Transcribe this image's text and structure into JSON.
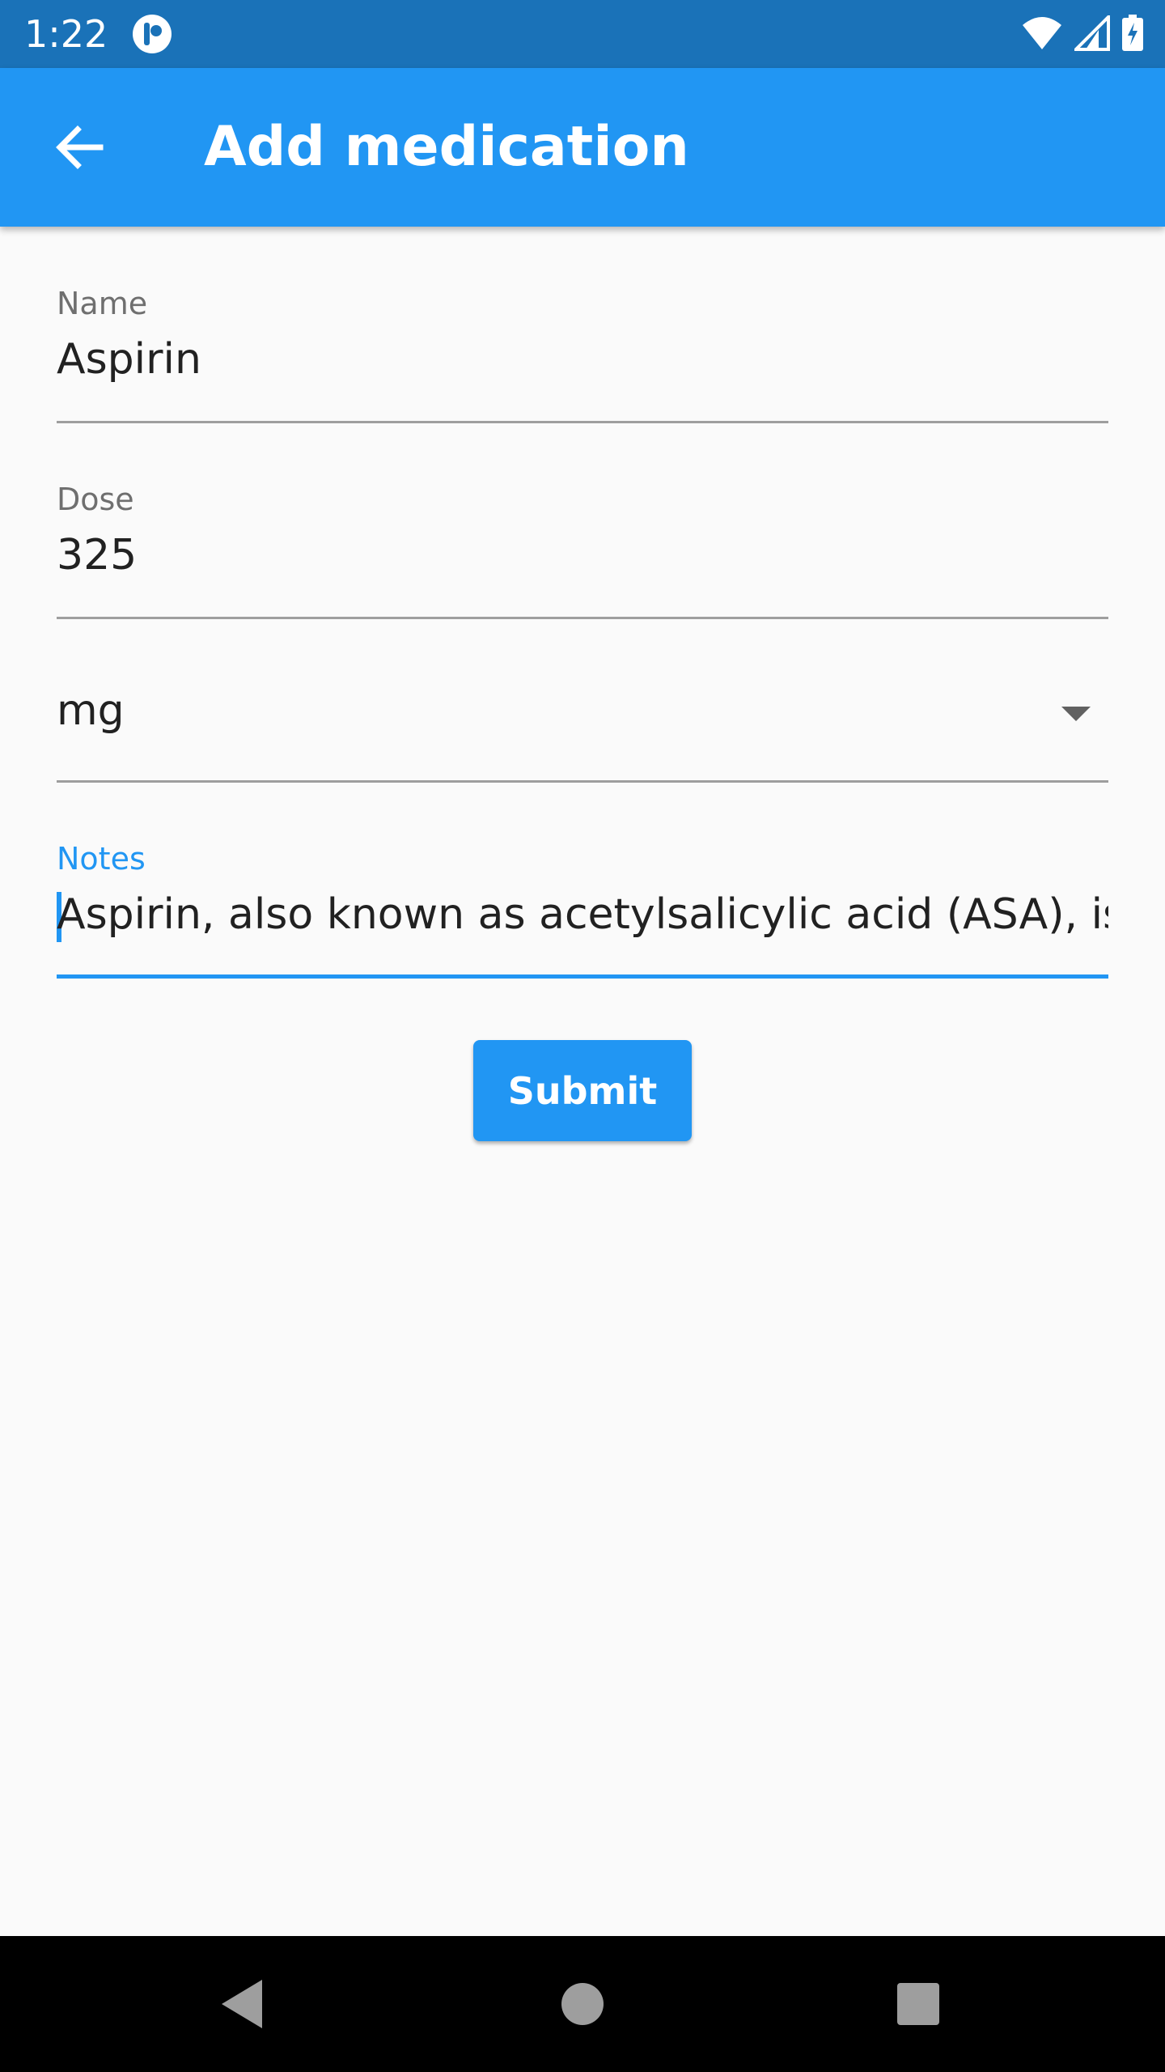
{
  "status_bar": {
    "time": "1:22",
    "icons": [
      "app-notification-icon",
      "wifi-icon",
      "signal-icon",
      "battery-charging-icon"
    ]
  },
  "app_bar": {
    "title": "Add medication",
    "back_icon": "arrow-back-icon"
  },
  "form": {
    "name": {
      "label": "Name",
      "value": "Aspirin"
    },
    "dose": {
      "label": "Dose",
      "value": "325"
    },
    "unit": {
      "selected": "mg"
    },
    "notes": {
      "label": "Notes",
      "value": "Aspirin, also known as acetylsalicylic acid (ASA), is a"
    },
    "submit_label": "Submit"
  },
  "colors": {
    "status_bar": "#1a72b8",
    "app_bar": "#2196f3",
    "accent": "#2196f3",
    "background": "#fafafa"
  },
  "nav_bar": {
    "buttons": [
      "back-triangle-icon",
      "home-circle-icon",
      "recents-square-icon"
    ]
  }
}
